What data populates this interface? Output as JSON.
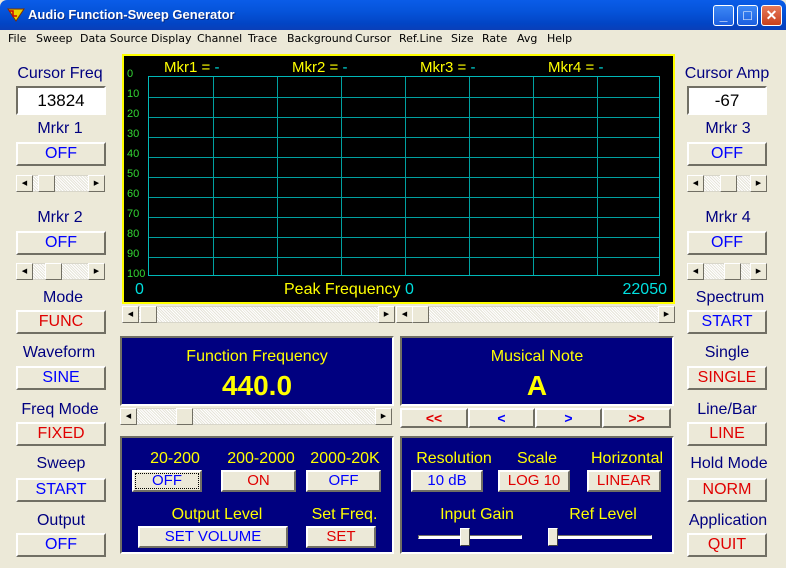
{
  "window": {
    "title": "Audio Function-Sweep Generator"
  },
  "menu": [
    "File",
    "Sweep",
    "Data Source",
    "Display",
    "Channel",
    "Trace",
    "Background",
    "Cursor",
    "Ref.Line",
    "Size",
    "Rate",
    "Avg",
    "Help"
  ],
  "left": {
    "cursor_freq_label": "Cursor Freq",
    "cursor_freq_value": "13824",
    "mrkr1_label": "Mrkr 1",
    "mrkr1_value": "OFF",
    "mrkr1_slider": 0.3,
    "mrkr2_label": "Mrkr 2",
    "mrkr2_value": "OFF",
    "mrkr2_slider": 0.25,
    "mode_label": "Mode",
    "mode_value": "FUNC",
    "waveform_label": "Waveform",
    "waveform_value": "SINE",
    "freqmode_label": "Freq Mode",
    "freqmode_value": "FIXED",
    "sweep_label": "Sweep",
    "sweep_value": "START",
    "output_label": "Output",
    "output_value": "OFF"
  },
  "right": {
    "cursor_amp_label": "Cursor Amp",
    "cursor_amp_value": "-67",
    "mrkr3_label": "Mrkr 3",
    "mrkr3_value": "OFF",
    "mrkr3_slider": 0.55,
    "mrkr4_label": "Mrkr 4",
    "mrkr4_value": "OFF",
    "mrkr4_slider": 0.6,
    "spectrum_label": "Spectrum",
    "spectrum_value": "START",
    "single_label": "Single",
    "single_value": "SINGLE",
    "linebar_label": "Line/Bar",
    "linebar_value": "LINE",
    "holdmode_label": "Hold Mode",
    "holdmode_value": "NORM",
    "application_label": "Application",
    "application_value": "QUIT"
  },
  "display": {
    "markers": [
      {
        "label": "Mkr1 = ",
        "value": "-"
      },
      {
        "label": "Mkr2 = ",
        "value": "-"
      },
      {
        "label": "Mkr3 = ",
        "value": "-"
      },
      {
        "label": "Mkr4 = ",
        "value": "-"
      }
    ],
    "y_labels": [
      "0",
      "10",
      "20",
      "30",
      "40",
      "50",
      "60",
      "70",
      "80",
      "90",
      "100"
    ],
    "x_start": "0",
    "x_end": "22050",
    "peak_label": "Peak Frequency ",
    "peak_value": "0"
  },
  "function_panel": {
    "label": "Function Frequency",
    "value": "440.0",
    "slider": 0.2
  },
  "note_panel": {
    "label": "Musical Note",
    "value": "A",
    "nav": [
      "<<",
      "<",
      ">",
      ">>"
    ]
  },
  "range_panel": {
    "ranges": [
      {
        "label": "20-200",
        "value": "OFF"
      },
      {
        "label": "200-2000",
        "value": "ON"
      },
      {
        "label": "2000-20K",
        "value": "OFF"
      }
    ],
    "output_level_label": "Output Level",
    "output_level_button": "SET VOLUME",
    "set_freq_label": "Set Freq.",
    "set_freq_button": "SET"
  },
  "analysis_panel": {
    "resolution_label": "Resolution",
    "resolution_value": "10 dB",
    "scale_label": "Scale",
    "scale_value": "LOG 10",
    "horizontal_label": "Horizontal",
    "horizontal_value": "LINEAR",
    "input_gain_label": "Input Gain",
    "input_gain_level": 0.45,
    "ref_level_label": "Ref Level",
    "ref_level_level": 0.0
  },
  "colors": {
    "accent": "#000080",
    "display_border": "#ffff00",
    "grid": "#00a0a0",
    "value_blue": "#0000ff",
    "value_red": "#e00000"
  }
}
